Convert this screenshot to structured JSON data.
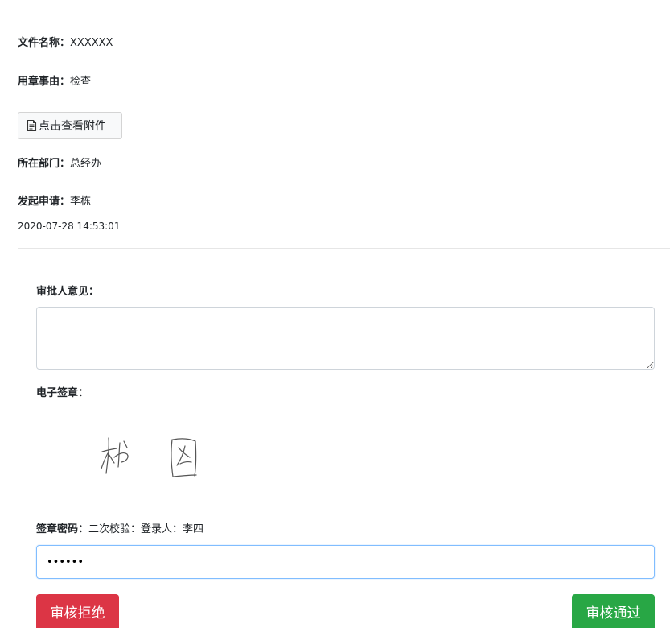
{
  "document": {
    "name_label": "文件名称：",
    "name_value": "XXXXXX",
    "reason_label": "用章事由：",
    "reason_value": "检查",
    "attachment_button": "点击查看附件",
    "dept_label": "所在部门：",
    "dept_value": "总经办",
    "applicant_label": "发起申请：",
    "applicant_value": "李栋",
    "timestamp": "2020-07-28 14:53:01"
  },
  "approval": {
    "opinion_label": "审批人意见：",
    "opinion_value": "",
    "signature_label": "电子签章：",
    "signature_text": "杨图",
    "password_label": "签章密码：",
    "password_hint": "二次校验：登录人：李四",
    "password_value": "••••••",
    "reject_button": "审核拒绝",
    "approve_button": "审核通过"
  },
  "colors": {
    "reject": "#dc3545",
    "approve": "#28a745",
    "focus_border": "#80bdff"
  },
  "icons": {
    "attachment": "file-text-icon"
  }
}
